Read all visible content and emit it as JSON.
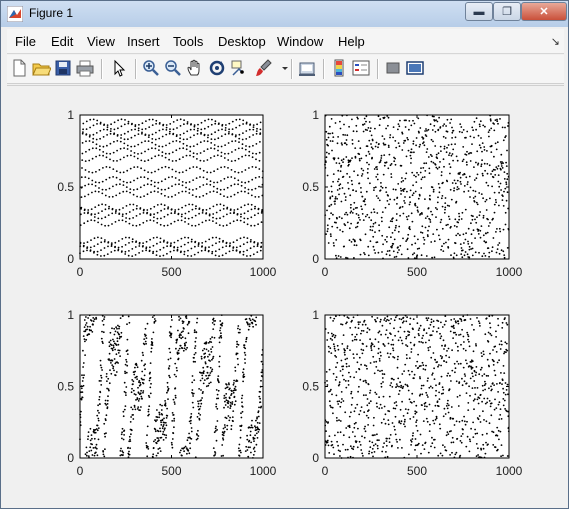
{
  "window": {
    "title": "Figure 1",
    "minimize": "▬",
    "maximize": "❐",
    "close": "✕"
  },
  "menu": {
    "items": [
      "File",
      "Edit",
      "View",
      "Insert",
      "Tools",
      "Desktop",
      "Window",
      "Help"
    ],
    "overflow_icon": "dock-arrow-icon"
  },
  "toolbar": {
    "buttons": [
      "new-figure-icon",
      "open-file-icon",
      "save-icon",
      "print-icon",
      "pointer-icon",
      "zoom-in-icon",
      "zoom-out-icon",
      "pan-hand-icon",
      "rotate-3d-icon",
      "data-cursor-icon",
      "brush-icon",
      "link-plot-icon",
      "colorbar-icon",
      "legend-icon",
      "hide-plot-tools-icon",
      "show-plot-tools-icon"
    ]
  },
  "chart_data": [
    {
      "type": "scatter",
      "xlim": [
        0,
        1000
      ],
      "ylim": [
        0,
        1
      ],
      "xticks": [
        "0",
        "500",
        "1000"
      ],
      "yticks": [
        "0",
        "0.5",
        "1"
      ],
      "marker_color": "#000000",
      "pattern": "horizontal banded lattice (structured sequence)"
    },
    {
      "type": "scatter",
      "xlim": [
        0,
        1000
      ],
      "ylim": [
        0,
        1
      ],
      "xticks": [
        "0",
        "500",
        "1000"
      ],
      "yticks": [
        "0",
        "0.5",
        "1"
      ],
      "marker_color": "#000000",
      "pattern": "uniform random"
    },
    {
      "type": "scatter",
      "xlim": [
        0,
        1000
      ],
      "ylim": [
        0,
        1
      ],
      "xticks": [
        "0",
        "500",
        "1000"
      ],
      "yticks": [
        "0",
        "0.5",
        "1"
      ],
      "marker_color": "#000000",
      "pattern": "diagonal streaks (weakly correlated)"
    },
    {
      "type": "scatter",
      "xlim": [
        0,
        1000
      ],
      "ylim": [
        0,
        1
      ],
      "xticks": [
        "0",
        "500",
        "1000"
      ],
      "yticks": [
        "0",
        "0.5",
        "1"
      ],
      "marker_color": "#000000",
      "pattern": "uniform random"
    }
  ]
}
